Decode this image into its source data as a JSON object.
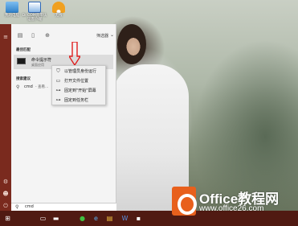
{
  "desktop": {
    "icons": [
      {
        "label": "我的电脑",
        "icon": "computer-icon"
      },
      {
        "label": "Dr.COM宽带认证客户端",
        "icon": "drcom-icon"
      },
      {
        "label": "无线",
        "icon": "wifi-icon"
      }
    ]
  },
  "start_menu": {
    "filter_label": "筛选器",
    "best_match_header": "最佳匹配",
    "best_match": {
      "name": "命令提示符",
      "subtitle": "桌面应用"
    },
    "web_header": "搜索建议",
    "web_query": "cmd",
    "web_suffix": "- 查看..."
  },
  "context_menu": {
    "items": [
      {
        "label": "以管理员身份运行",
        "icon": "admin-shield-icon"
      },
      {
        "label": "打开文件位置",
        "icon": "folder-icon"
      },
      {
        "label": "固定到\"开始\"屏幕",
        "icon": "pin-icon"
      },
      {
        "label": "固定到任务栏",
        "icon": "pin-icon"
      }
    ]
  },
  "search": {
    "value": "cmd"
  },
  "watermark": {
    "title": "Office教程网",
    "url": "www.office26.com"
  },
  "colors": {
    "start_rail": "#7a2a1e",
    "taskbar": "#501a12",
    "panel": "#f4f4f4",
    "annotation_arrow": "#e02020",
    "watermark_logo": "#e8601c"
  }
}
